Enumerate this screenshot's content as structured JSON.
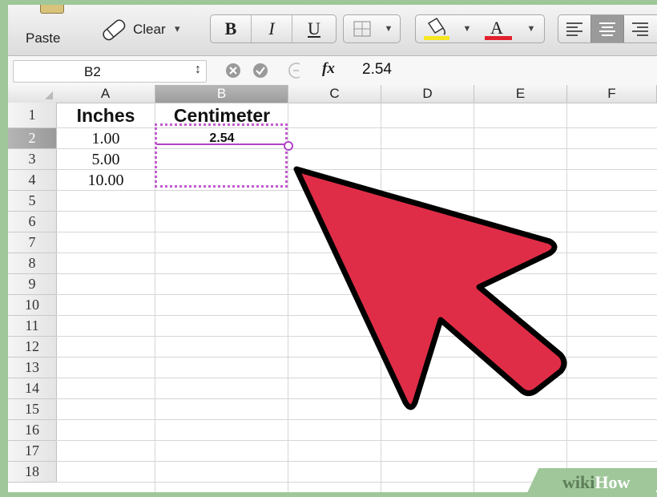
{
  "toolbar": {
    "paste_label": "Paste",
    "clear_label": "Clear",
    "clear_arrow": "▾",
    "bold_label": "B",
    "italic_label": "I",
    "underline_label": "U"
  },
  "formula_bar": {
    "name_box": "B2",
    "stepper": "↕",
    "fx_label": "fx",
    "value": "2.54"
  },
  "columns": [
    "A",
    "B",
    "C",
    "D",
    "E",
    "F"
  ],
  "rows": [
    "1",
    "2",
    "3",
    "4",
    "5",
    "6",
    "7",
    "8",
    "9",
    "10",
    "11",
    "12",
    "13",
    "14",
    "15",
    "16",
    "17",
    "18"
  ],
  "cells": {
    "A1": "Inches",
    "B1": "Centimeter",
    "A2": "1.00",
    "B2": "2.54",
    "A3": "5.00",
    "A4": "10.00"
  },
  "selection": {
    "active_cell": "B2",
    "range": "B2:B4",
    "selected_row": "2",
    "selected_col": "B"
  },
  "watermark": {
    "prefix": "wiki",
    "suffix": "How"
  },
  "colors": {
    "arrow_fill": "#e02d47",
    "selection": "#c45ad1",
    "watermark_bg": "#9fc79a"
  }
}
